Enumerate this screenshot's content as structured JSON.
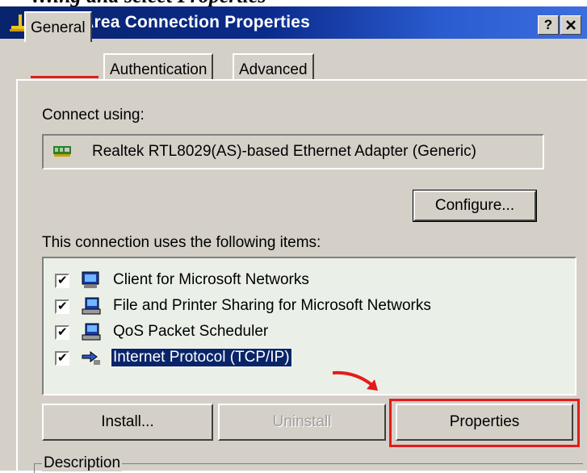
{
  "caption": "…ing and select Properties",
  "window": {
    "title": "Local Area Connection Properties",
    "help_label": "?",
    "close_label": "✕"
  },
  "tabs": [
    {
      "label": "General",
      "active": true
    },
    {
      "label": "Authentication",
      "active": false
    },
    {
      "label": "Advanced",
      "active": false
    }
  ],
  "connect_using": {
    "label": "Connect using:",
    "adapter": "Realtek RTL8029(AS)-based Ethernet Adapter (Generic)",
    "configure_label": "Configure..."
  },
  "items_section": {
    "label": "This connection uses the following items:",
    "items": [
      {
        "label": "Client for Microsoft Networks",
        "checked": true,
        "icon": "network-client-icon"
      },
      {
        "label": "File and Printer Sharing for Microsoft Networks",
        "checked": true,
        "icon": "network-service-icon"
      },
      {
        "label": "QoS Packet Scheduler",
        "checked": true,
        "icon": "network-service-icon"
      },
      {
        "label": "Internet Protocol (TCP/IP)",
        "checked": true,
        "selected": true,
        "icon": "protocol-icon"
      }
    ]
  },
  "buttons": {
    "install": "Install...",
    "uninstall": "Uninstall",
    "properties": "Properties"
  },
  "description": {
    "label": "Description"
  },
  "colors": {
    "title_bar": "#0a246a",
    "dialog_face": "#d4d0c8",
    "highlight": "#0a246a",
    "annotation_red": "#e41b1b"
  }
}
